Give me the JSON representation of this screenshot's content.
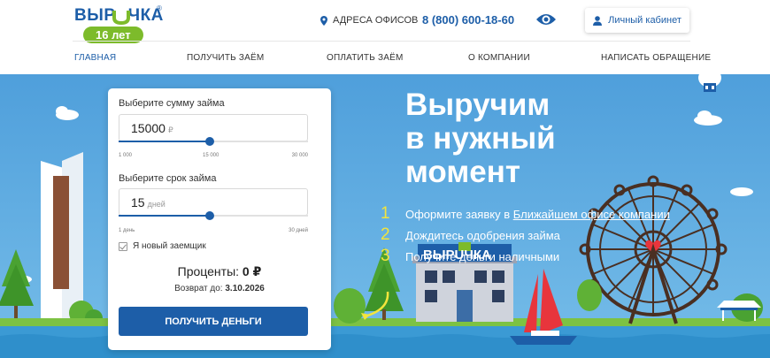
{
  "header": {
    "logo": {
      "text": "ВЫРUЧКА",
      "badge": "16 лет",
      "reg": "®"
    },
    "address_label": "АДРЕСА ОФИСОВ",
    "phone": "8 (800) 600-18-60",
    "cabinet_label": "Личный кабинет"
  },
  "nav": {
    "items": [
      {
        "label": "ГЛАВНАЯ",
        "active": true
      },
      {
        "label": "ПОЛУЧИТЬ ЗАЁМ",
        "active": false
      },
      {
        "label": "ОПЛАТИТЬ ЗАЁМ",
        "active": false
      },
      {
        "label": "О КОМПАНИИ",
        "active": false
      },
      {
        "label": "НАПИСАТЬ ОБРАЩЕНИЕ",
        "active": false
      }
    ]
  },
  "hero": {
    "headline_lines": [
      "Выручим",
      "в нужный",
      "момент"
    ],
    "steps": [
      {
        "num": "1",
        "text_before": "Оформите заявку в ",
        "link": "Ближайшем офисе компании"
      },
      {
        "num": "2",
        "text_before": "Дождитесь одобрения займа",
        "link": ""
      },
      {
        "num": "3",
        "text_before": "Получите деньги наличными",
        "link": ""
      }
    ],
    "building_sign": "ВЫРUЧКА"
  },
  "calculator": {
    "amount": {
      "label": "Выберите сумму займа",
      "value": "15000",
      "unit": "₽",
      "min_label": "1 000",
      "mid_label": "15 000",
      "max_label": "30 000",
      "slider_fraction": 0.483
    },
    "term": {
      "label": "Выберите срок займа",
      "value": "15",
      "unit": "дней",
      "min_label": "1 день",
      "max_label": "30 дней",
      "slider_fraction": 0.483
    },
    "new_borrower_label": "Я новый заемщик",
    "new_borrower_checked": true,
    "interest_label": "Проценты:",
    "interest_value": "0 ₽",
    "return_label": "Возврат до:",
    "return_date": "3.10.2026",
    "submit_label": "ПОЛУЧИТЬ ДЕНЬГИ"
  },
  "colors": {
    "brand_blue": "#1d5ea8",
    "brand_green": "#7dbb2b",
    "sky": "#5ea9df",
    "step_number": "#f3e43c"
  },
  "icons": [
    "location-pin-icon",
    "eye-icon",
    "user-icon",
    "checkbox-icon"
  ]
}
